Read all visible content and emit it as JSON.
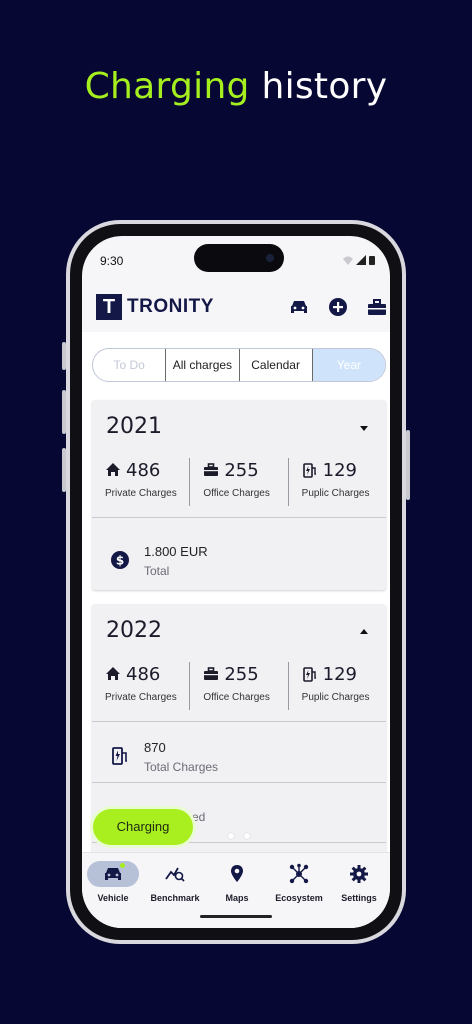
{
  "promo": {
    "title_accent": "Charging",
    "title_rest": " history"
  },
  "status": {
    "time": "9:30"
  },
  "app": {
    "logo_letter": "T",
    "brand": "TRONITY"
  },
  "tabs": [
    {
      "label": "To Do",
      "state": "disabled"
    },
    {
      "label": "All charges",
      "state": "normal"
    },
    {
      "label": "Calendar",
      "state": "normal"
    },
    {
      "label": "Year",
      "state": "selected"
    }
  ],
  "cards": [
    {
      "year": "2021",
      "expanded": false,
      "stats": [
        {
          "icon": "home-icon",
          "value": "486",
          "label": "Private Charges"
        },
        {
          "icon": "briefcase-icon",
          "value": "255",
          "label": "Office Charges"
        },
        {
          "icon": "charging-station-icon",
          "value": "129",
          "label": "Puplic Charges"
        }
      ],
      "rows": [
        {
          "icon": "dollar-icon",
          "value": "1.800 EUR",
          "label": "Total"
        }
      ]
    },
    {
      "year": "2022",
      "expanded": true,
      "stats": [
        {
          "icon": "home-icon",
          "value": "486",
          "label": "Private Charges"
        },
        {
          "icon": "briefcase-icon",
          "value": "255",
          "label": "Office Charges"
        },
        {
          "icon": "charging-station-icon",
          "value": "129",
          "label": "Puplic Charges"
        }
      ],
      "rows": [
        {
          "icon": "charging-station-icon",
          "value": "870",
          "label": "Total Charges"
        },
        {
          "icon": "",
          "value": "",
          "label": "ed"
        }
      ]
    }
  ],
  "fab": {
    "label": "Charging"
  },
  "nav": [
    {
      "icon": "car-icon",
      "label": "Vehicle",
      "active": true
    },
    {
      "icon": "benchmark-icon",
      "label": "Benchmark",
      "active": false
    },
    {
      "icon": "map-pin-icon",
      "label": "Maps",
      "active": false
    },
    {
      "icon": "ecosystem-icon",
      "label": "Ecosystem",
      "active": false
    },
    {
      "icon": "gear-icon",
      "label": "Settings",
      "active": false
    }
  ],
  "colors": {
    "background": "#070733",
    "accent": "#a6ef1f",
    "brand": "#141846",
    "selected_tab": "#cfe4fb"
  }
}
